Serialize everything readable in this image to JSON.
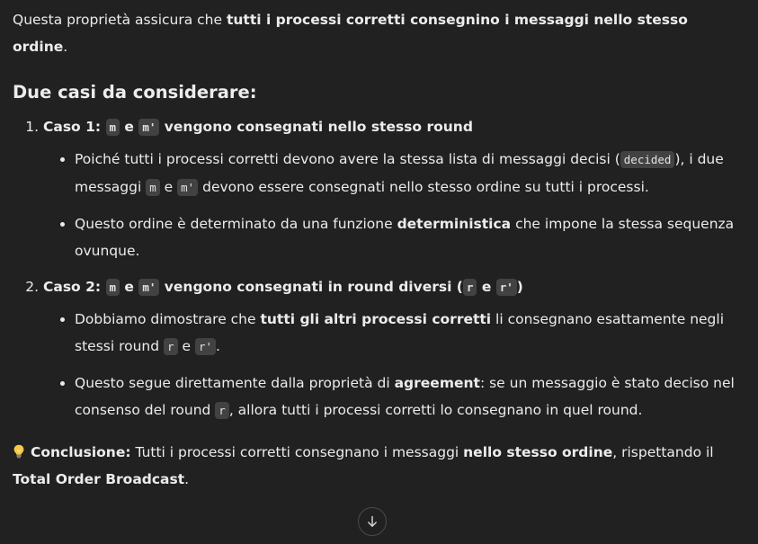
{
  "intro": {
    "text_a": "Questa proprietà assicura che ",
    "bold_a": "tutti i processi corretti consegnino i messaggi nello stesso ordine",
    "text_b": "."
  },
  "heading": "Due casi da considerare:",
  "case1": {
    "label": "Caso 1:",
    "code_m": "m",
    "conj": " e ",
    "code_m2": "m'",
    "title_rest": " vengono consegnati nello stesso round",
    "bullet1": {
      "t1": "Poiché tutti i processi corretti devono avere la stessa lista di messaggi decisi (",
      "code": "decided",
      "t2": "), i due messaggi ",
      "code_m": "m",
      "t3": " e ",
      "code_m2": "m'",
      "t4": " devono essere consegnati nello stesso ordine su tutti i processi."
    },
    "bullet2": {
      "t1": "Questo ordine è determinato da una funzione ",
      "bold": "deterministica",
      "t2": " che impone la stessa sequenza ovunque."
    }
  },
  "case2": {
    "label": "Caso 2:",
    "code_m": "m",
    "conj": " e ",
    "code_m2": "m'",
    "title_rest": " vengono consegnati in round diversi (",
    "code_r": "r",
    "conj2": " e ",
    "code_r2": "r'",
    "title_end": ")",
    "bullet1": {
      "t1": "Dobbiamo dimostrare che ",
      "bold": "tutti gli altri processi corretti",
      "t2": " li consegnano esattamente negli stessi round ",
      "code_r": "r",
      "t3": " e ",
      "code_r2": "r'",
      "t4": "."
    },
    "bullet2": {
      "t1": "Questo segue direttamente dalla proprietà di ",
      "bold": "agreement",
      "t2": ": se un messaggio è stato deciso nel consenso del round ",
      "code_r": "r",
      "t3": ", allora tutti i processi corretti lo consegnano in quel round."
    }
  },
  "conclusion": {
    "icon": "lightbulb-icon",
    "label": "Conclusione:",
    "t1": " Tutti i processi corretti consegnano i messaggi ",
    "bold1": "nello stesso ordine",
    "t2": ", rispettando il ",
    "bold2": "Total Order Broadcast",
    "t3": "."
  },
  "scroll_button": {
    "icon": "arrow-down-icon"
  }
}
